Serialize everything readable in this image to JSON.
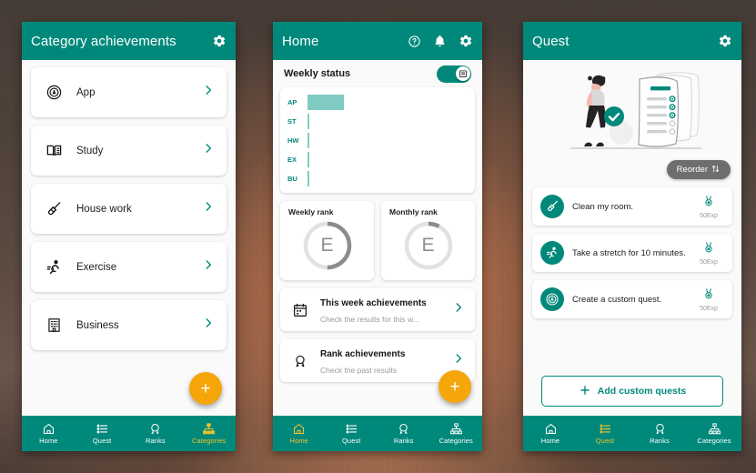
{
  "background": {
    "theme_colors": {
      "primary": "#00897b",
      "accent_yellow": "#f4c22b",
      "fab_orange": "#f6a609",
      "bar_teal": "#80cbc4"
    }
  },
  "phone_categories": {
    "appbar": {
      "title": "Category achievements",
      "settings_icon": "gear-icon"
    },
    "categories": [
      {
        "label": "App",
        "icon": "app-badge-icon"
      },
      {
        "label": "Study",
        "icon": "book-icon"
      },
      {
        "label": "House work",
        "icon": "broom-icon"
      },
      {
        "label": "Exercise",
        "icon": "running-person-icon"
      },
      {
        "label": "Business",
        "icon": "office-building-icon"
      }
    ],
    "fab_label": "+",
    "bottom_nav": [
      {
        "label": "Home",
        "icon": "home-icon",
        "active": false
      },
      {
        "label": "Quest",
        "icon": "list-icon",
        "active": false
      },
      {
        "label": "Ranks",
        "icon": "medal-icon",
        "active": false
      },
      {
        "label": "Categories",
        "icon": "sitemap-icon",
        "active": true
      }
    ]
  },
  "phone_home": {
    "appbar": {
      "title": "Home",
      "help_icon": "help-circle-icon",
      "bell_icon": "bell-icon",
      "settings_icon": "gear-icon"
    },
    "weekly_status": {
      "title": "Weekly status",
      "toggle_on": true,
      "toggle_icon": "calendar-icon"
    },
    "ranks": [
      {
        "label": "Weekly rank",
        "grade": "E",
        "progress_percent": 50
      },
      {
        "label": "Monthly rank",
        "grade": "E",
        "progress_percent": 8
      }
    ],
    "achievements": [
      {
        "title": "This week achievements",
        "subtitle": "Check the results for this w...",
        "icon": "calendar-icon"
      },
      {
        "title": "Rank achievements",
        "subtitle": "Check the past results",
        "icon": "medal-icon"
      }
    ],
    "fab_label": "+",
    "bottom_nav": [
      {
        "label": "Home",
        "icon": "home-icon",
        "active": true
      },
      {
        "label": "Quest",
        "icon": "list-icon",
        "active": false
      },
      {
        "label": "Ranks",
        "icon": "medal-icon",
        "active": false
      },
      {
        "label": "Categories",
        "icon": "sitemap-icon",
        "active": false
      }
    ]
  },
  "phone_quest": {
    "appbar": {
      "title": "Quest",
      "settings_icon": "gear-icon"
    },
    "illustration": "person-with-checklist-illustration",
    "reorder_button": {
      "label": "Reorder",
      "icon": "sort-arrows-icon"
    },
    "quests": [
      {
        "text": "Clean my room.",
        "icon": "broom-icon",
        "exp": "50Exp",
        "exp_icon": "medal-icon"
      },
      {
        "text": "Take a stretch for 10 minutes.",
        "icon": "running-person-icon",
        "exp": "50Exp",
        "exp_icon": "medal-icon"
      },
      {
        "text": "Create a custom quest.",
        "icon": "app-badge-icon",
        "exp": "50Exp",
        "exp_icon": "medal-icon"
      }
    ],
    "add_button": {
      "label": "Add custom quests",
      "icon": "plus-icon"
    },
    "bottom_nav": [
      {
        "label": "Home",
        "icon": "home-icon",
        "active": false
      },
      {
        "label": "Quest",
        "icon": "list-icon",
        "active": true
      },
      {
        "label": "Ranks",
        "icon": "medal-icon",
        "active": false
      },
      {
        "label": "Categories",
        "icon": "sitemap-icon",
        "active": false
      }
    ]
  },
  "chart_data": {
    "type": "bar",
    "orientation": "horizontal",
    "title": "Weekly status",
    "categories": [
      "AP",
      "ST",
      "HW",
      "EX",
      "BU"
    ],
    "category_names": [
      "App",
      "Study",
      "House work",
      "Exercise",
      "Business"
    ],
    "values": [
      23,
      0,
      0,
      0,
      0
    ],
    "xlabel": "",
    "ylabel": "",
    "xlim": [
      0,
      100
    ],
    "grid": false,
    "legend": "none",
    "bar_color": "#80cbc4",
    "label_color": "#00897b"
  }
}
